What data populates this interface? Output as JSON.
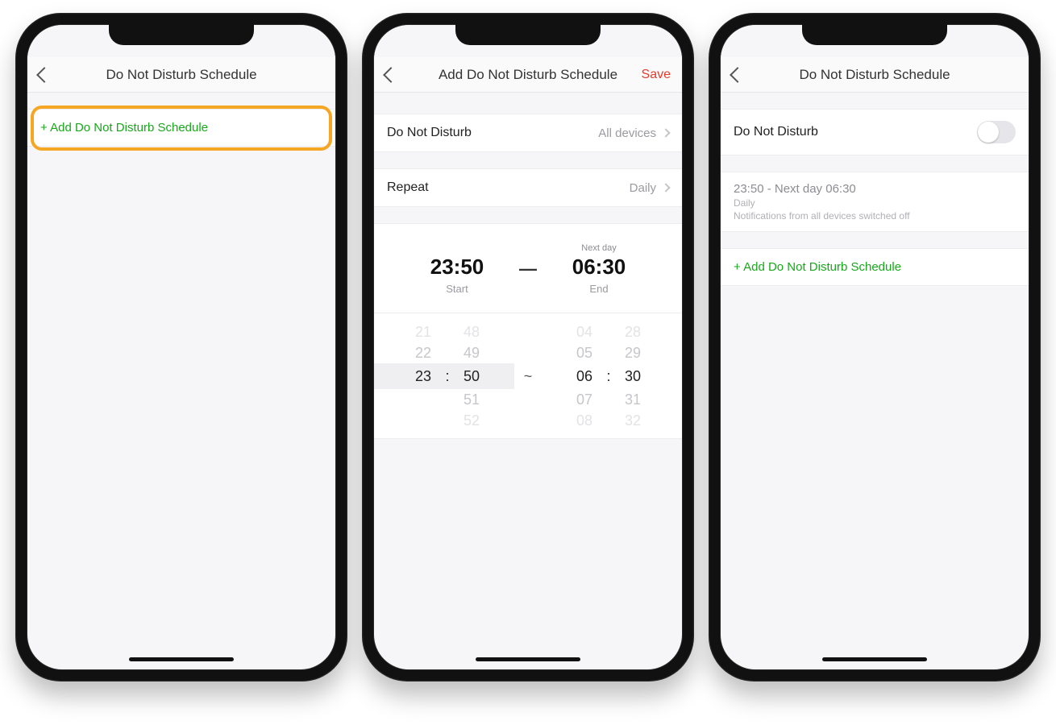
{
  "phone1": {
    "title": "Do Not Disturb Schedule",
    "add_label": "+ Add Do Not Disturb Schedule"
  },
  "phone2": {
    "title": "Add Do Not Disturb Schedule",
    "save": "Save",
    "dnd_label": "Do Not Disturb",
    "dnd_value": "All devices",
    "repeat_label": "Repeat",
    "repeat_value": "Daily",
    "start_time": "23:50",
    "end_time": "06:30",
    "nextday": "Next day",
    "start_label": "Start",
    "end_label": "End",
    "picker": {
      "sh": [
        "21",
        "22",
        "23",
        "",
        ""
      ],
      "sm": [
        "48",
        "49",
        "50",
        "51",
        "52"
      ],
      "eh": [
        "04",
        "05",
        "06",
        "07",
        "08"
      ],
      "em": [
        "28",
        "29",
        "30",
        "31",
        "32"
      ],
      "sel_sh": "23",
      "sel_sm": "50",
      "sel_eh": "06",
      "sel_em": "30",
      "tilde": "~",
      "colon": ":"
    }
  },
  "phone3": {
    "title": "Do Not Disturb Schedule",
    "dnd_label": "Do Not Disturb",
    "sched_line1": "23:50 - Next day 06:30",
    "sched_line2": "Daily",
    "sched_line3": "Notifications from all devices switched off",
    "add_label": "+ Add Do Not Disturb Schedule"
  }
}
